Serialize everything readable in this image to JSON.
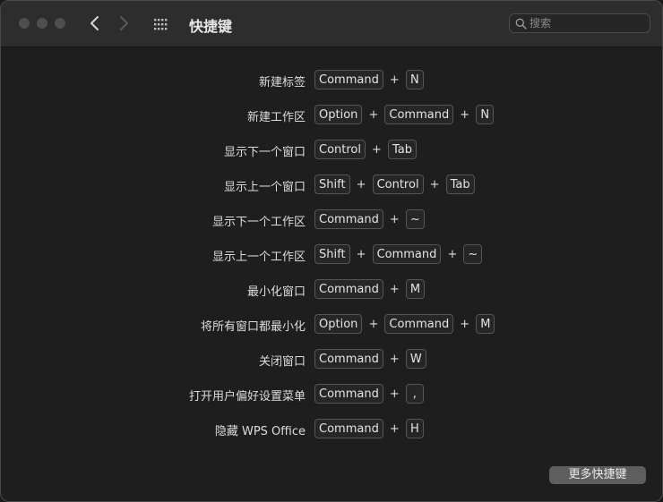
{
  "window": {
    "title": "快捷键"
  },
  "search": {
    "placeholder": "搜索"
  },
  "shortcuts": [
    {
      "label": "新建标签",
      "keys": [
        "Command",
        "N"
      ]
    },
    {
      "label": "新建工作区",
      "keys": [
        "Option",
        "Command",
        "N"
      ]
    },
    {
      "label": "显示下一个窗口",
      "keys": [
        "Control",
        "Tab"
      ]
    },
    {
      "label": "显示上一个窗口",
      "keys": [
        "Shift",
        "Control",
        "Tab"
      ]
    },
    {
      "label": "显示下一个工作区",
      "keys": [
        "Command",
        "~"
      ]
    },
    {
      "label": "显示上一个工作区",
      "keys": [
        "Shift",
        "Command",
        "~"
      ]
    },
    {
      "label": "最小化窗口",
      "keys": [
        "Command",
        "M"
      ]
    },
    {
      "label": "将所有窗口都最小化",
      "keys": [
        "Option",
        "Command",
        "M"
      ]
    },
    {
      "label": "关闭窗口",
      "keys": [
        "Command",
        "W"
      ]
    },
    {
      "label": "打开用户偏好设置菜单",
      "keys": [
        "Command",
        ","
      ]
    },
    {
      "label": "隐藏 WPS Office",
      "keys": [
        "Command",
        "H"
      ]
    }
  ],
  "separator": "+",
  "footer": {
    "more_label": "更多快捷键"
  }
}
